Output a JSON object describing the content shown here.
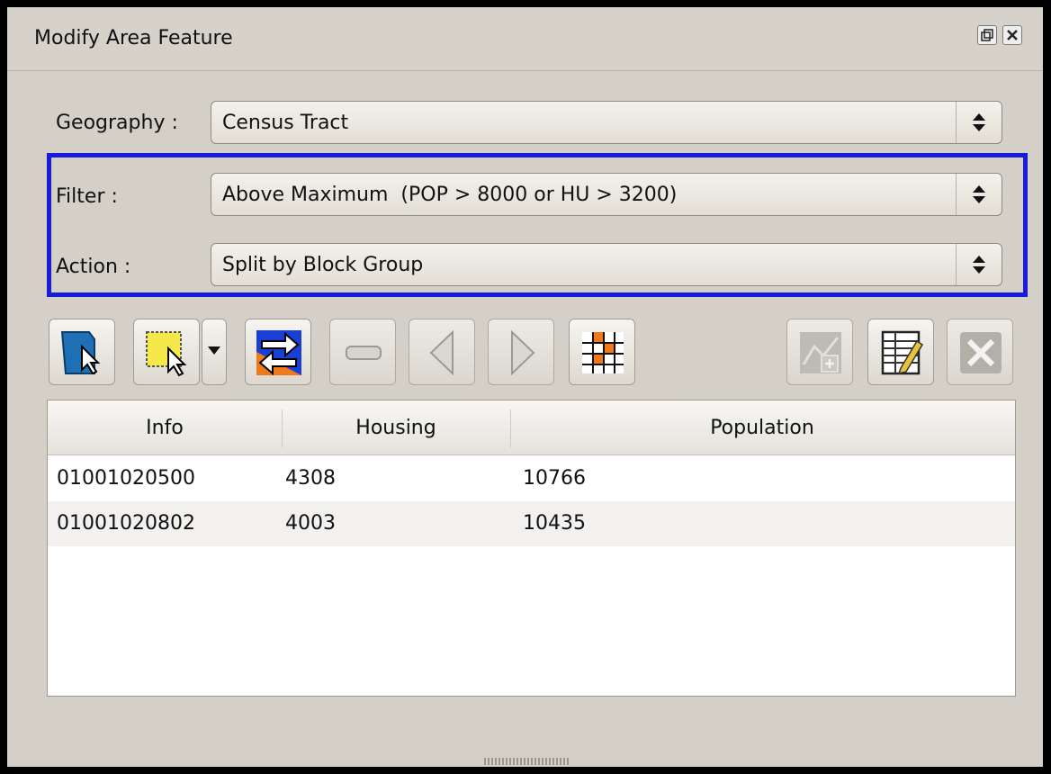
{
  "window": {
    "title": "Modify Area Feature",
    "float_icon": "float-window-icon",
    "close_icon": "close-window-icon"
  },
  "form": {
    "geography": {
      "label": "Geography :",
      "value": "Census Tract"
    },
    "filter": {
      "label": "Filter :",
      "value": "Above Maximum  (POP > 8000 or HU > 3200)"
    },
    "action": {
      "label": "Action :",
      "value": "Split by Block Group"
    }
  },
  "toolbar": {
    "tools": [
      {
        "icon": "select-feature-icon",
        "enabled": true
      },
      {
        "icon": "rectangle-select-icon",
        "enabled": true
      },
      {
        "icon": "dropdown-arrow-icon",
        "enabled": true
      },
      {
        "icon": "swap-icon",
        "enabled": true
      },
      {
        "icon": "minus-icon",
        "enabled": false
      },
      {
        "icon": "previous-icon",
        "enabled": false
      },
      {
        "icon": "next-icon",
        "enabled": false
      },
      {
        "icon": "grid-icon",
        "enabled": true
      },
      {
        "icon": "add-to-map-icon",
        "enabled": false
      },
      {
        "icon": "edit-table-icon",
        "enabled": true
      },
      {
        "icon": "delete-icon",
        "enabled": false
      }
    ]
  },
  "table": {
    "columns": [
      "Info",
      "Housing",
      "Population"
    ],
    "rows": [
      {
        "info": "01001020500",
        "housing": "4308",
        "population": "10766"
      },
      {
        "info": "01001020802",
        "housing": "4003",
        "population": "10435"
      }
    ]
  },
  "colors": {
    "highlight_border": "#1a1adb",
    "panel_bg": "#d4d0c8"
  }
}
